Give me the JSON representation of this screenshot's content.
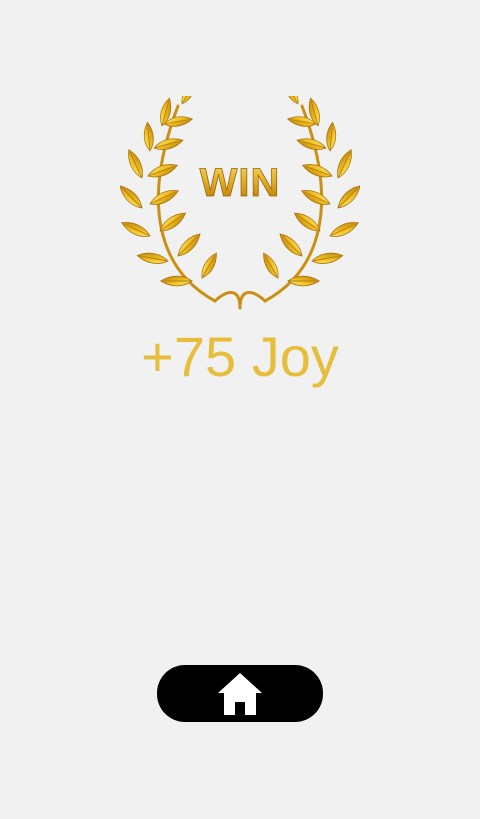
{
  "trophy": {
    "label": "WIN",
    "icon": "laurel-wreath-icon",
    "colors": {
      "gold_light": "#f7d44a",
      "gold": "#e3a915",
      "gold_dark": "#a8700a"
    }
  },
  "reward": {
    "text": "+75 Joy",
    "color": "#e6be3c"
  },
  "home_button": {
    "icon": "home-icon",
    "background": "#000000"
  }
}
